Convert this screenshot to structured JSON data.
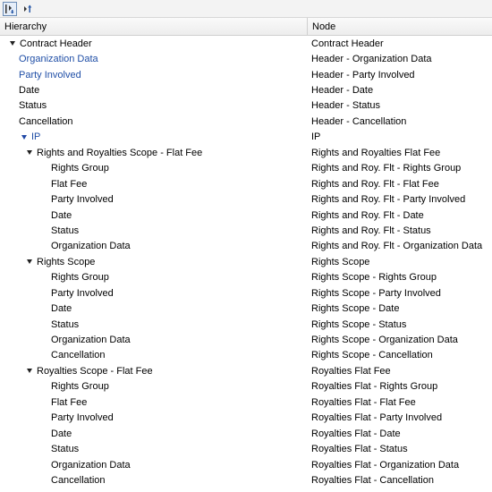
{
  "columns": {
    "hierarchy": "Hierarchy",
    "node": "Node"
  },
  "rows": [
    {
      "label": "Contract Header",
      "node": "Contract Header",
      "level": 0,
      "expander": true,
      "link": false
    },
    {
      "label": "Organization Data",
      "node": "Header - Organization Data",
      "level": 1,
      "expander": false,
      "link": true
    },
    {
      "label": "Party Involved",
      "node": "Header - Party Involved",
      "level": 1,
      "expander": false,
      "link": true
    },
    {
      "label": "Date",
      "node": "Header - Date",
      "level": 1,
      "expander": false,
      "link": false
    },
    {
      "label": "Status",
      "node": "Header - Status",
      "level": 1,
      "expander": false,
      "link": false
    },
    {
      "label": "Cancellation",
      "node": "Header - Cancellation",
      "level": 1,
      "expander": false,
      "link": false
    },
    {
      "label": "IP",
      "node": "IP",
      "level": 1,
      "expander": true,
      "link": true
    },
    {
      "label": "Rights and Royalties Scope - Flat Fee",
      "node": "Rights and Royalties Flat Fee",
      "level": 2,
      "expander": true,
      "link": false
    },
    {
      "label": "Rights Group",
      "node": "Rights and Roy. Flt - Rights Group",
      "level": 3,
      "expander": false,
      "link": false
    },
    {
      "label": "Flat Fee",
      "node": "Rights and Roy. Flt - Flat Fee",
      "level": 3,
      "expander": false,
      "link": false
    },
    {
      "label": "Party Involved",
      "node": "Rights and Roy. Flt - Party Involved",
      "level": 3,
      "expander": false,
      "link": false
    },
    {
      "label": "Date",
      "node": "Rights and Roy. Flt - Date",
      "level": 3,
      "expander": false,
      "link": false
    },
    {
      "label": "Status",
      "node": "Rights and Roy. Flt - Status",
      "level": 3,
      "expander": false,
      "link": false
    },
    {
      "label": "Organization Data",
      "node": "Rights and Roy. Flt - Organization Data",
      "level": 3,
      "expander": false,
      "link": false
    },
    {
      "label": "Rights Scope",
      "node": "Rights Scope",
      "level": 2,
      "expander": true,
      "link": false
    },
    {
      "label": "Rights Group",
      "node": "Rights Scope - Rights Group",
      "level": 3,
      "expander": false,
      "link": false
    },
    {
      "label": "Party Involved",
      "node": "Rights Scope - Party Involved",
      "level": 3,
      "expander": false,
      "link": false
    },
    {
      "label": "Date",
      "node": "Rights Scope - Date",
      "level": 3,
      "expander": false,
      "link": false
    },
    {
      "label": "Status",
      "node": "Rights Scope - Status",
      "level": 3,
      "expander": false,
      "link": false
    },
    {
      "label": "Organization Data",
      "node": "Rights Scope - Organization Data",
      "level": 3,
      "expander": false,
      "link": false
    },
    {
      "label": "Cancellation",
      "node": "Rights Scope - Cancellation",
      "level": 3,
      "expander": false,
      "link": false
    },
    {
      "label": "Royalties Scope - Flat Fee",
      "node": "Royalties Flat Fee",
      "level": 2,
      "expander": true,
      "link": false
    },
    {
      "label": "Rights Group",
      "node": "Royalties Flat - Rights Group",
      "level": 3,
      "expander": false,
      "link": false
    },
    {
      "label": "Flat Fee",
      "node": "Royalties Flat - Flat Fee",
      "level": 3,
      "expander": false,
      "link": false
    },
    {
      "label": "Party Involved",
      "node": "Royalties Flat - Party Involved",
      "level": 3,
      "expander": false,
      "link": false
    },
    {
      "label": "Date",
      "node": "Royalties Flat - Date",
      "level": 3,
      "expander": false,
      "link": false
    },
    {
      "label": "Status",
      "node": "Royalties Flat - Status",
      "level": 3,
      "expander": false,
      "link": false
    },
    {
      "label": "Organization Data",
      "node": "Royalties Flat - Organization Data",
      "level": 3,
      "expander": false,
      "link": false
    },
    {
      "label": "Cancellation",
      "node": "Royalties Flat - Cancellation",
      "level": 3,
      "expander": false,
      "link": false
    }
  ],
  "toolbar": {
    "icons": [
      "expand-all-icon",
      "collapse-all-icon"
    ]
  },
  "colors": {
    "link": "#1f4ea6",
    "expander": "#222222",
    "expander_link": "#2149a6"
  }
}
